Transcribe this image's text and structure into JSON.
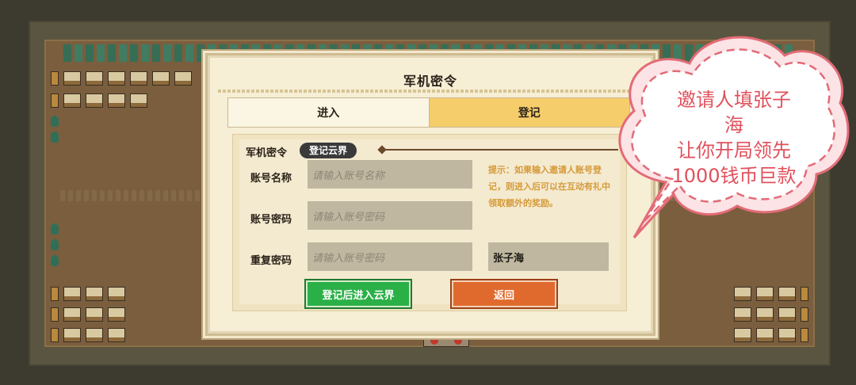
{
  "dialog": {
    "title": "军机密令",
    "tabs": [
      {
        "label": "进入",
        "active": false
      },
      {
        "label": "登记",
        "active": true
      }
    ],
    "section_label": "军机密令",
    "section_pill": "登记云界",
    "fields": {
      "account_name": {
        "label": "账号名称",
        "placeholder": "请输入账号名称"
      },
      "account_password": {
        "label": "账号密码",
        "placeholder": "请输入账号密码"
      },
      "repeat_password": {
        "label": "重复密码",
        "placeholder": "请输入账号密码"
      }
    },
    "hint": "提示：如果输入邀请人账号登记，则进入后可以在互动有礼中领取额外的奖励。",
    "inviter_value": "张子海",
    "buttons": {
      "register": "登记后进入云界",
      "back": "返回"
    }
  },
  "promo": {
    "lines": [
      "邀请人填张子",
      "海",
      "让你开局领先",
      "1000钱币巨款"
    ],
    "color": "#e0515c"
  },
  "colors": {
    "active_tab": "#f5cd6b",
    "green_button": "#2bb048",
    "orange_button": "#e06a2e",
    "hint_text": "#d59a3a"
  }
}
